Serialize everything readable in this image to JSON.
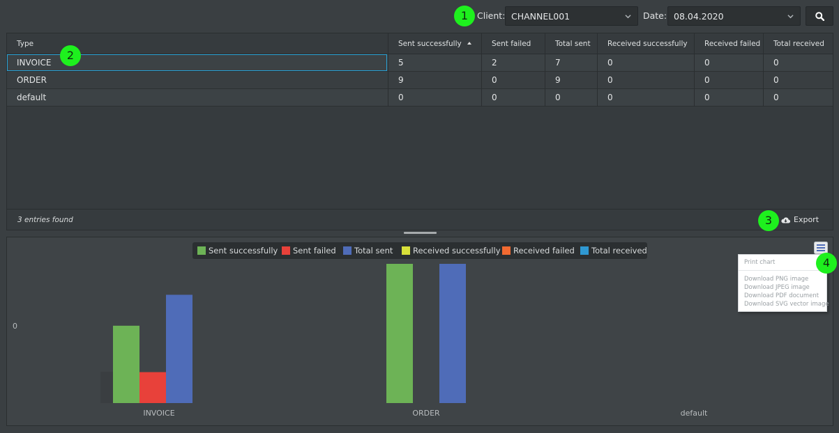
{
  "toolbar": {
    "client_label": "Client:",
    "client_value": "CHANNEL001",
    "date_label": "Date:",
    "date_value": "08.04.2020"
  },
  "grid": {
    "columns": [
      "Type",
      "Sent successfully",
      "Sent failed",
      "Total sent",
      "Received successfully",
      "Received failed",
      "Total received"
    ],
    "sorted_column": "Sent successfully",
    "rows": [
      [
        "INVOICE",
        "5",
        "2",
        "7",
        "0",
        "0",
        "0"
      ],
      [
        "ORDER",
        "9",
        "0",
        "9",
        "0",
        "0",
        "0"
      ],
      [
        "default",
        "0",
        "0",
        "0",
        "0",
        "0",
        "0"
      ]
    ],
    "selected_row": "INVOICE",
    "entries_text": "3 entries found",
    "export_label": "Export"
  },
  "chart_menu": {
    "items": [
      "Print chart",
      "Download PNG image",
      "Download JPEG image",
      "Download PDF document",
      "Download SVG vector image"
    ]
  },
  "markers": [
    "1",
    "2",
    "3",
    "4"
  ],
  "colors": {
    "sent_successfully": "#6db356",
    "sent_failed": "#e8413a",
    "total_sent": "#4f6cb8",
    "received_successfully": "#d8e03a",
    "received_failed": "#f26a31",
    "total_received": "#2f98d2",
    "selection": "#2aa3d6",
    "marker": "#1ef01e"
  },
  "chart_data": {
    "type": "bar",
    "categories": [
      "INVOICE",
      "ORDER",
      "default"
    ],
    "series": [
      {
        "name": "Sent successfully",
        "values": [
          5,
          9,
          0
        ]
      },
      {
        "name": "Sent failed",
        "values": [
          2,
          0,
          0
        ]
      },
      {
        "name": "Total sent",
        "values": [
          7,
          9,
          0
        ]
      },
      {
        "name": "Received successfully",
        "values": [
          0,
          0,
          0
        ]
      },
      {
        "name": "Received failed",
        "values": [
          0,
          0,
          0
        ]
      },
      {
        "name": "Total received",
        "values": [
          0,
          0,
          0
        ]
      }
    ],
    "y_tick_label": "0",
    "ylim": [
      0,
      9
    ],
    "legend_position": "top-center",
    "grid": false
  }
}
